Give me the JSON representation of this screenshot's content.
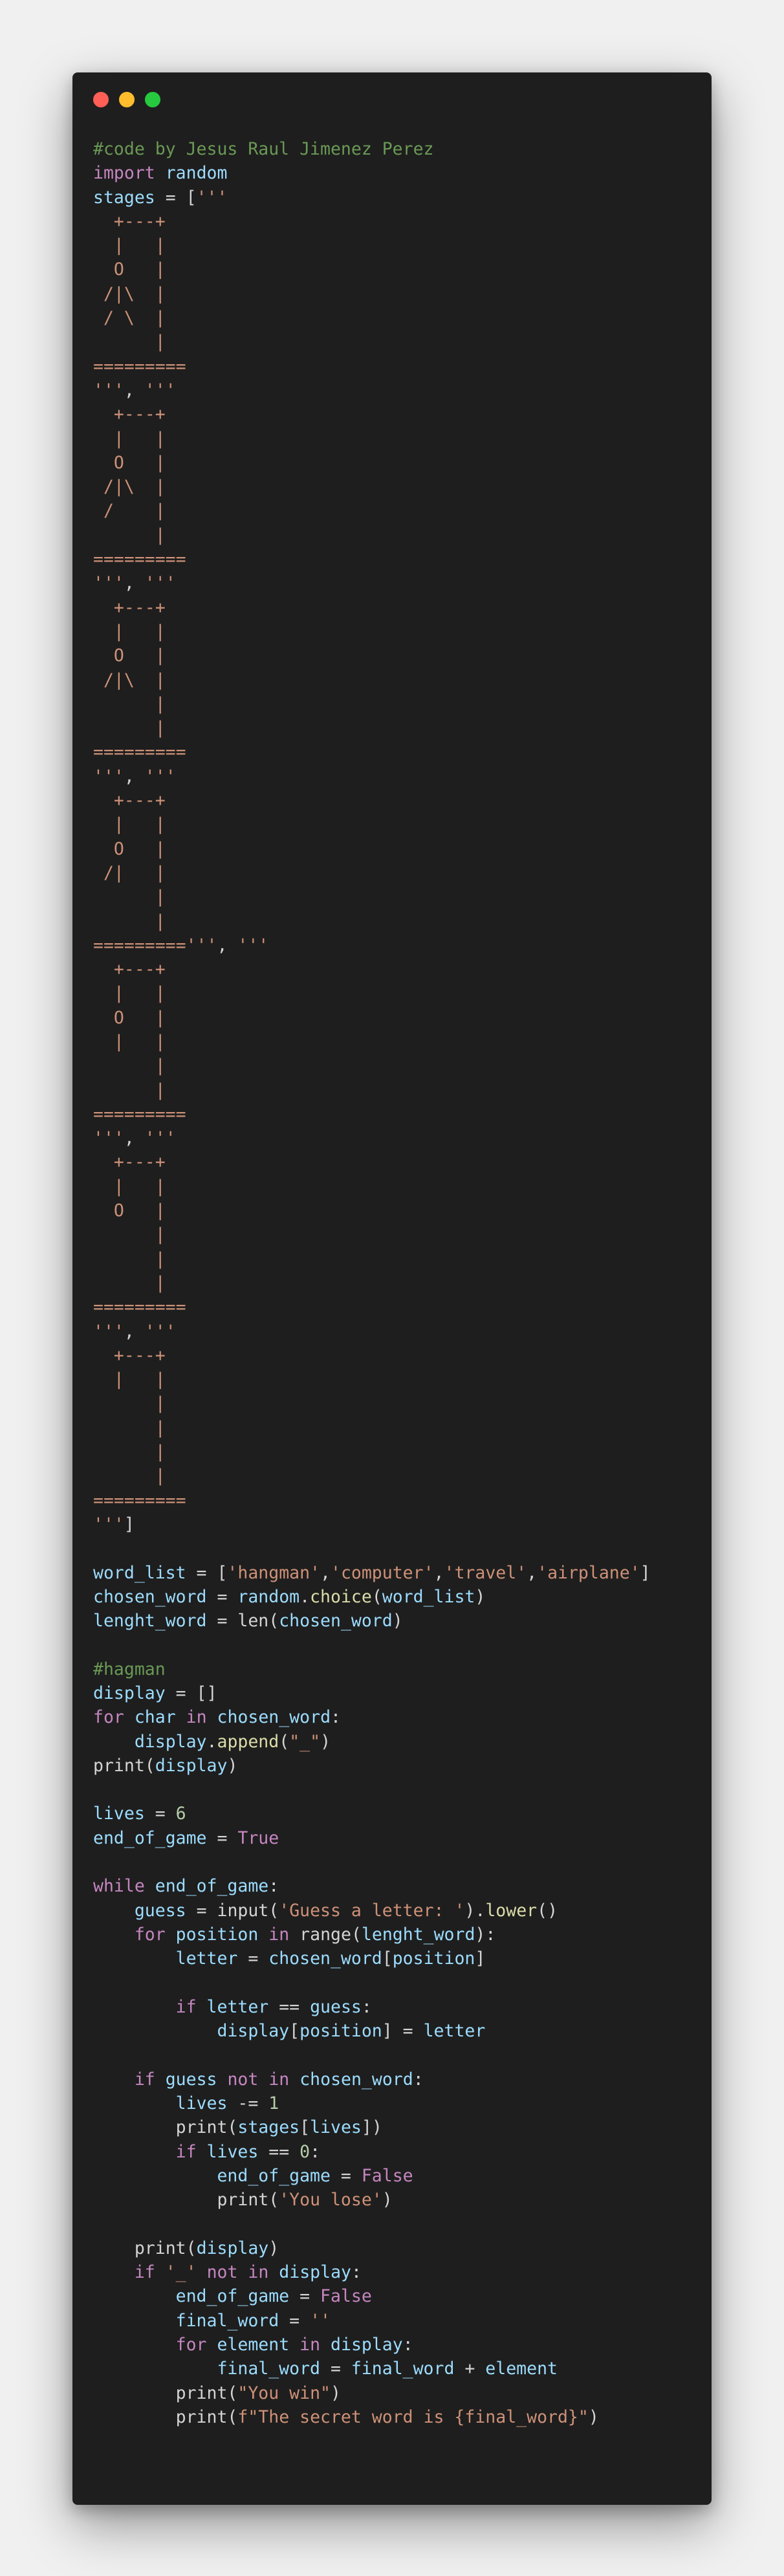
{
  "window": {
    "controls": {
      "close": "#ff5f56",
      "minimize": "#ffbd2e",
      "maximize": "#27c93f"
    },
    "background": "#1e1e1e"
  },
  "colors": {
    "comment": "#6a9955",
    "keyword": "#c586c0",
    "name": "#9cdcfe",
    "string": "#ce9178",
    "function": "#dcdcaa",
    "number": "#b5cea8",
    "plain": "#d4d4d4"
  },
  "code": {
    "lines": [
      [
        [
          "#code by Jesus Raul Jimenez Perez",
          "comment"
        ]
      ],
      [
        [
          "import",
          "keyword"
        ],
        [
          " ",
          "op"
        ],
        [
          "random",
          "name"
        ]
      ],
      [
        [
          "stages",
          "name"
        ],
        [
          " = [",
          "op"
        ],
        [
          "'''",
          "string"
        ]
      ],
      [
        [
          "  +---+",
          "string"
        ]
      ],
      [
        [
          "  |   |",
          "string"
        ]
      ],
      [
        [
          "  O   |",
          "string"
        ]
      ],
      [
        [
          " /|\\  |",
          "string"
        ]
      ],
      [
        [
          " / \\  |",
          "string"
        ]
      ],
      [
        [
          "      |",
          "string"
        ]
      ],
      [
        [
          "=========",
          "string"
        ]
      ],
      [
        [
          "'''",
          "string"
        ],
        [
          ", ",
          "op"
        ],
        [
          "'''",
          "string"
        ]
      ],
      [
        [
          "  +---+",
          "string"
        ]
      ],
      [
        [
          "  |   |",
          "string"
        ]
      ],
      [
        [
          "  O   |",
          "string"
        ]
      ],
      [
        [
          " /|\\  |",
          "string"
        ]
      ],
      [
        [
          " /    |",
          "string"
        ]
      ],
      [
        [
          "      |",
          "string"
        ]
      ],
      [
        [
          "=========",
          "string"
        ]
      ],
      [
        [
          "'''",
          "string"
        ],
        [
          ", ",
          "op"
        ],
        [
          "'''",
          "string"
        ]
      ],
      [
        [
          "  +---+",
          "string"
        ]
      ],
      [
        [
          "  |   |",
          "string"
        ]
      ],
      [
        [
          "  O   |",
          "string"
        ]
      ],
      [
        [
          " /|\\  |",
          "string"
        ]
      ],
      [
        [
          "      |",
          "string"
        ]
      ],
      [
        [
          "      |",
          "string"
        ]
      ],
      [
        [
          "=========",
          "string"
        ]
      ],
      [
        [
          "'''",
          "string"
        ],
        [
          ", ",
          "op"
        ],
        [
          "'''",
          "string"
        ]
      ],
      [
        [
          "  +---+",
          "string"
        ]
      ],
      [
        [
          "  |   |",
          "string"
        ]
      ],
      [
        [
          "  O   |",
          "string"
        ]
      ],
      [
        [
          " /|   |",
          "string"
        ]
      ],
      [
        [
          "      |",
          "string"
        ]
      ],
      [
        [
          "      |",
          "string"
        ]
      ],
      [
        [
          "=========",
          "string"
        ],
        [
          "'''",
          "string"
        ],
        [
          ", ",
          "op"
        ],
        [
          "'''",
          "string"
        ]
      ],
      [
        [
          "  +---+",
          "string"
        ]
      ],
      [
        [
          "  |   |",
          "string"
        ]
      ],
      [
        [
          "  O   |",
          "string"
        ]
      ],
      [
        [
          "  |   |",
          "string"
        ]
      ],
      [
        [
          "      |",
          "string"
        ]
      ],
      [
        [
          "      |",
          "string"
        ]
      ],
      [
        [
          "=========",
          "string"
        ]
      ],
      [
        [
          "'''",
          "string"
        ],
        [
          ", ",
          "op"
        ],
        [
          "'''",
          "string"
        ]
      ],
      [
        [
          "  +---+",
          "string"
        ]
      ],
      [
        [
          "  |   |",
          "string"
        ]
      ],
      [
        [
          "  O   |",
          "string"
        ]
      ],
      [
        [
          "      |",
          "string"
        ]
      ],
      [
        [
          "      |",
          "string"
        ]
      ],
      [
        [
          "      |",
          "string"
        ]
      ],
      [
        [
          "=========",
          "string"
        ]
      ],
      [
        [
          "'''",
          "string"
        ],
        [
          ", ",
          "op"
        ],
        [
          "'''",
          "string"
        ]
      ],
      [
        [
          "  +---+",
          "string"
        ]
      ],
      [
        [
          "  |   |",
          "string"
        ]
      ],
      [
        [
          "      |",
          "string"
        ]
      ],
      [
        [
          "      |",
          "string"
        ]
      ],
      [
        [
          "      |",
          "string"
        ]
      ],
      [
        [
          "      |",
          "string"
        ]
      ],
      [
        [
          "=========",
          "string"
        ]
      ],
      [
        [
          "'''",
          "string"
        ],
        [
          "]",
          "op"
        ]
      ],
      [],
      [
        [
          "word_list",
          "name"
        ],
        [
          " = [",
          "op"
        ],
        [
          "'hangman'",
          "string"
        ],
        [
          ",",
          "op"
        ],
        [
          "'computer'",
          "string"
        ],
        [
          ",",
          "op"
        ],
        [
          "'travel'",
          "string"
        ],
        [
          ",",
          "op"
        ],
        [
          "'airplane'",
          "string"
        ],
        [
          "]",
          "op"
        ]
      ],
      [
        [
          "chosen_word",
          "name"
        ],
        [
          " = ",
          "op"
        ],
        [
          "random",
          "name"
        ],
        [
          ".",
          "op"
        ],
        [
          "choice",
          "func"
        ],
        [
          "(",
          "op"
        ],
        [
          "word_list",
          "name"
        ],
        [
          ")",
          "op"
        ]
      ],
      [
        [
          "lenght_word",
          "name"
        ],
        [
          " = ",
          "op"
        ],
        [
          "len",
          "op"
        ],
        [
          "(",
          "op"
        ],
        [
          "chosen_word",
          "name"
        ],
        [
          ")",
          "op"
        ]
      ],
      [],
      [
        [
          "#hagman",
          "comment"
        ]
      ],
      [
        [
          "display",
          "name"
        ],
        [
          " = []",
          "op"
        ]
      ],
      [
        [
          "for",
          "keyword"
        ],
        [
          " ",
          "op"
        ],
        [
          "char",
          "name"
        ],
        [
          " ",
          "op"
        ],
        [
          "in",
          "keyword"
        ],
        [
          " ",
          "op"
        ],
        [
          "chosen_word",
          "name"
        ],
        [
          ":",
          "op"
        ]
      ],
      [
        [
          "    ",
          "op"
        ],
        [
          "display",
          "name"
        ],
        [
          ".",
          "op"
        ],
        [
          "append",
          "func"
        ],
        [
          "(",
          "op"
        ],
        [
          "\"_\"",
          "string"
        ],
        [
          ")",
          "op"
        ]
      ],
      [
        [
          "print",
          "op"
        ],
        [
          "(",
          "op"
        ],
        [
          "display",
          "name"
        ],
        [
          ")",
          "op"
        ]
      ],
      [],
      [
        [
          "lives",
          "name"
        ],
        [
          " = ",
          "op"
        ],
        [
          "6",
          "number"
        ]
      ],
      [
        [
          "end_of_game",
          "name"
        ],
        [
          " = ",
          "op"
        ],
        [
          "True",
          "bool"
        ]
      ],
      [],
      [
        [
          "while",
          "keyword"
        ],
        [
          " ",
          "op"
        ],
        [
          "end_of_game",
          "name"
        ],
        [
          ":",
          "op"
        ]
      ],
      [
        [
          "    ",
          "op"
        ],
        [
          "guess",
          "name"
        ],
        [
          " = ",
          "op"
        ],
        [
          "input",
          "op"
        ],
        [
          "(",
          "op"
        ],
        [
          "'Guess a letter: '",
          "string"
        ],
        [
          ").",
          "op"
        ],
        [
          "lower",
          "func"
        ],
        [
          "()",
          "op"
        ]
      ],
      [
        [
          "    ",
          "op"
        ],
        [
          "for",
          "keyword"
        ],
        [
          " ",
          "op"
        ],
        [
          "position",
          "name"
        ],
        [
          " ",
          "op"
        ],
        [
          "in",
          "keyword"
        ],
        [
          " ",
          "op"
        ],
        [
          "range",
          "op"
        ],
        [
          "(",
          "op"
        ],
        [
          "lenght_word",
          "name"
        ],
        [
          "):",
          "op"
        ]
      ],
      [
        [
          "        ",
          "op"
        ],
        [
          "letter",
          "name"
        ],
        [
          " = ",
          "op"
        ],
        [
          "chosen_word",
          "name"
        ],
        [
          "[",
          "op"
        ],
        [
          "position",
          "name"
        ],
        [
          "]",
          "op"
        ]
      ],
      [],
      [
        [
          "        ",
          "op"
        ],
        [
          "if",
          "keyword"
        ],
        [
          " ",
          "op"
        ],
        [
          "letter",
          "name"
        ],
        [
          " == ",
          "op"
        ],
        [
          "guess",
          "name"
        ],
        [
          ":",
          "op"
        ]
      ],
      [
        [
          "            ",
          "op"
        ],
        [
          "display",
          "name"
        ],
        [
          "[",
          "op"
        ],
        [
          "position",
          "name"
        ],
        [
          "] = ",
          "op"
        ],
        [
          "letter",
          "name"
        ]
      ],
      [],
      [
        [
          "    ",
          "op"
        ],
        [
          "if",
          "keyword"
        ],
        [
          " ",
          "op"
        ],
        [
          "guess",
          "name"
        ],
        [
          " ",
          "op"
        ],
        [
          "not",
          "keyword"
        ],
        [
          " ",
          "op"
        ],
        [
          "in",
          "keyword"
        ],
        [
          " ",
          "op"
        ],
        [
          "chosen_word",
          "name"
        ],
        [
          ":",
          "op"
        ]
      ],
      [
        [
          "        ",
          "op"
        ],
        [
          "lives",
          "name"
        ],
        [
          " -= ",
          "op"
        ],
        [
          "1",
          "number"
        ]
      ],
      [
        [
          "        ",
          "op"
        ],
        [
          "print",
          "op"
        ],
        [
          "(",
          "op"
        ],
        [
          "stages",
          "name"
        ],
        [
          "[",
          "op"
        ],
        [
          "lives",
          "name"
        ],
        [
          "])",
          "op"
        ]
      ],
      [
        [
          "        ",
          "op"
        ],
        [
          "if",
          "keyword"
        ],
        [
          " ",
          "op"
        ],
        [
          "lives",
          "name"
        ],
        [
          " == ",
          "op"
        ],
        [
          "0",
          "number"
        ],
        [
          ":",
          "op"
        ]
      ],
      [
        [
          "            ",
          "op"
        ],
        [
          "end_of_game",
          "name"
        ],
        [
          " = ",
          "op"
        ],
        [
          "False",
          "bool"
        ]
      ],
      [
        [
          "            ",
          "op"
        ],
        [
          "print",
          "op"
        ],
        [
          "(",
          "op"
        ],
        [
          "'You lose'",
          "string"
        ],
        [
          ")",
          "op"
        ]
      ],
      [],
      [
        [
          "    ",
          "op"
        ],
        [
          "print",
          "op"
        ],
        [
          "(",
          "op"
        ],
        [
          "display",
          "name"
        ],
        [
          ")",
          "op"
        ]
      ],
      [
        [
          "    ",
          "op"
        ],
        [
          "if",
          "keyword"
        ],
        [
          " ",
          "op"
        ],
        [
          "'_'",
          "string"
        ],
        [
          " ",
          "op"
        ],
        [
          "not",
          "keyword"
        ],
        [
          " ",
          "op"
        ],
        [
          "in",
          "keyword"
        ],
        [
          " ",
          "op"
        ],
        [
          "display",
          "name"
        ],
        [
          ":",
          "op"
        ]
      ],
      [
        [
          "        ",
          "op"
        ],
        [
          "end_of_game",
          "name"
        ],
        [
          " = ",
          "op"
        ],
        [
          "False",
          "bool"
        ]
      ],
      [
        [
          "        ",
          "op"
        ],
        [
          "final_word",
          "name"
        ],
        [
          " = ",
          "op"
        ],
        [
          "''",
          "string"
        ]
      ],
      [
        [
          "        ",
          "op"
        ],
        [
          "for",
          "keyword"
        ],
        [
          " ",
          "op"
        ],
        [
          "element",
          "name"
        ],
        [
          " ",
          "op"
        ],
        [
          "in",
          "keyword"
        ],
        [
          " ",
          "op"
        ],
        [
          "display",
          "name"
        ],
        [
          ":",
          "op"
        ]
      ],
      [
        [
          "            ",
          "op"
        ],
        [
          "final_word",
          "name"
        ],
        [
          " = ",
          "op"
        ],
        [
          "final_word",
          "name"
        ],
        [
          " + ",
          "op"
        ],
        [
          "element",
          "name"
        ]
      ],
      [
        [
          "        ",
          "op"
        ],
        [
          "print",
          "op"
        ],
        [
          "(",
          "op"
        ],
        [
          "\"You win\"",
          "string"
        ],
        [
          ")",
          "op"
        ]
      ],
      [
        [
          "        ",
          "op"
        ],
        [
          "print",
          "op"
        ],
        [
          "(",
          "op"
        ],
        [
          "f\"The secret word is {final_word}\"",
          "string"
        ],
        [
          ")",
          "op"
        ]
      ]
    ]
  }
}
